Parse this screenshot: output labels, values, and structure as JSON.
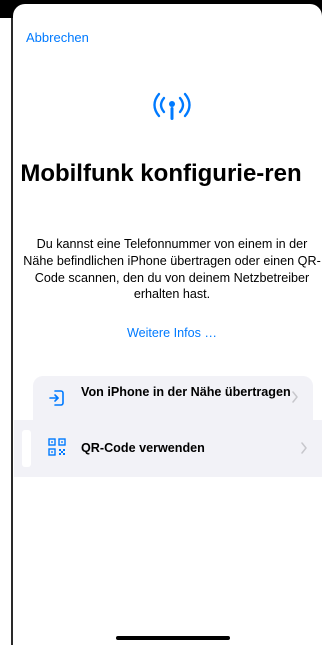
{
  "navigation": {
    "cancel_label": "Abbrechen"
  },
  "header": {
    "icon": "antenna-icon",
    "title": "Mobilfunk konfigurie-ren"
  },
  "description": "Du kannst eine Telefonnummer von einem in der Nähe befindlichen iPhone übertragen oder einen QR-Code scannen, den du von deinem Netzbetreiber erhalten hast.",
  "more_info": "Weitere Infos …",
  "options": [
    {
      "label": "Von iPhone in der Nähe übertragen",
      "icon": "transfer-icon"
    },
    {
      "label": "QR-Code verwenden",
      "icon": "qr-code-icon"
    }
  ],
  "colors": {
    "accent": "#007aff",
    "row_background": "#f2f2f7",
    "chevron": "#c7c7cc"
  }
}
